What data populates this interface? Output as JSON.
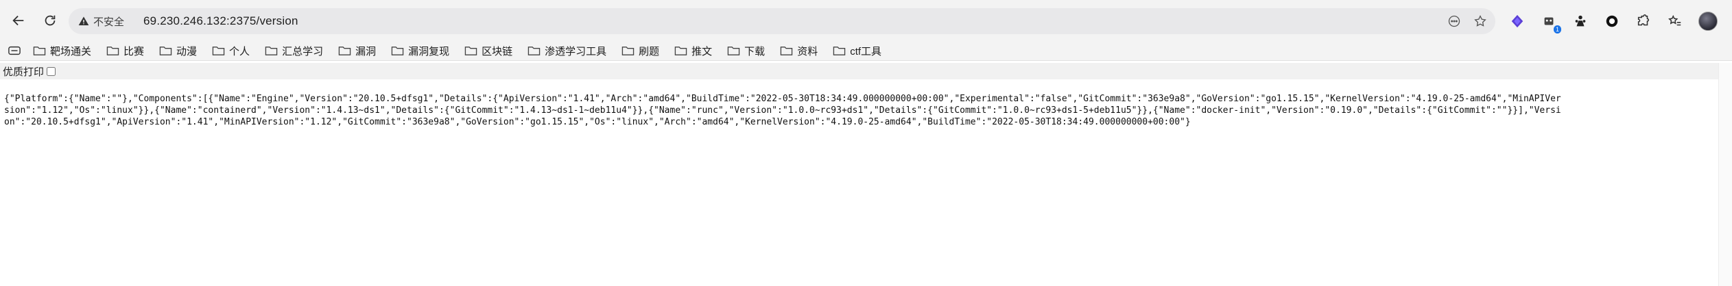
{
  "toolbar": {
    "security_label": "不安全",
    "url": "69.230.246.132:2375/version",
    "extension_badge": "1"
  },
  "bookmarks": [
    {
      "label": "靶场通关"
    },
    {
      "label": "比赛"
    },
    {
      "label": "动漫"
    },
    {
      "label": "个人"
    },
    {
      "label": "汇总学习"
    },
    {
      "label": "漏洞"
    },
    {
      "label": "漏洞复现"
    },
    {
      "label": "区块链"
    },
    {
      "label": "渗透学习工具"
    },
    {
      "label": "刷题"
    },
    {
      "label": "推文"
    },
    {
      "label": "下载"
    },
    {
      "label": "资料"
    },
    {
      "label": "ctf工具"
    }
  ],
  "pretty_print": {
    "label": "优质打印"
  },
  "content": {
    "json_text": "{\"Platform\":{\"Name\":\"\"},\"Components\":[{\"Name\":\"Engine\",\"Version\":\"20.10.5+dfsg1\",\"Details\":{\"ApiVersion\":\"1.41\",\"Arch\":\"amd64\",\"BuildTime\":\"2022-05-30T18:34:49.000000000+00:00\",\"Experimental\":\"false\",\"GitCommit\":\"363e9a8\",\"GoVersion\":\"go1.15.15\",\"KernelVersion\":\"4.19.0-25-amd64\",\"MinAPIVersion\":\"1.12\",\"Os\":\"linux\"}},{\"Name\":\"containerd\",\"Version\":\"1.4.13~ds1\",\"Details\":{\"GitCommit\":\"1.4.13~ds1-1~deb11u4\"}},{\"Name\":\"runc\",\"Version\":\"1.0.0~rc93+ds1\",\"Details\":{\"GitCommit\":\"1.0.0~rc93+ds1-5+deb11u5\"}},{\"Name\":\"docker-init\",\"Version\":\"0.19.0\",\"Details\":{\"GitCommit\":\"\"}}],\"Version\":\"20.10.5+dfsg1\",\"ApiVersion\":\"1.41\",\"MinAPIVersion\":\"1.12\",\"GitCommit\":\"363e9a8\",\"GoVersion\":\"go1.15.15\",\"Os\":\"linux\",\"Arch\":\"amd64\",\"KernelVersion\":\"4.19.0-25-amd64\",\"BuildTime\":\"2022-05-30T18:34:49.000000000+00:00\"}"
  }
}
